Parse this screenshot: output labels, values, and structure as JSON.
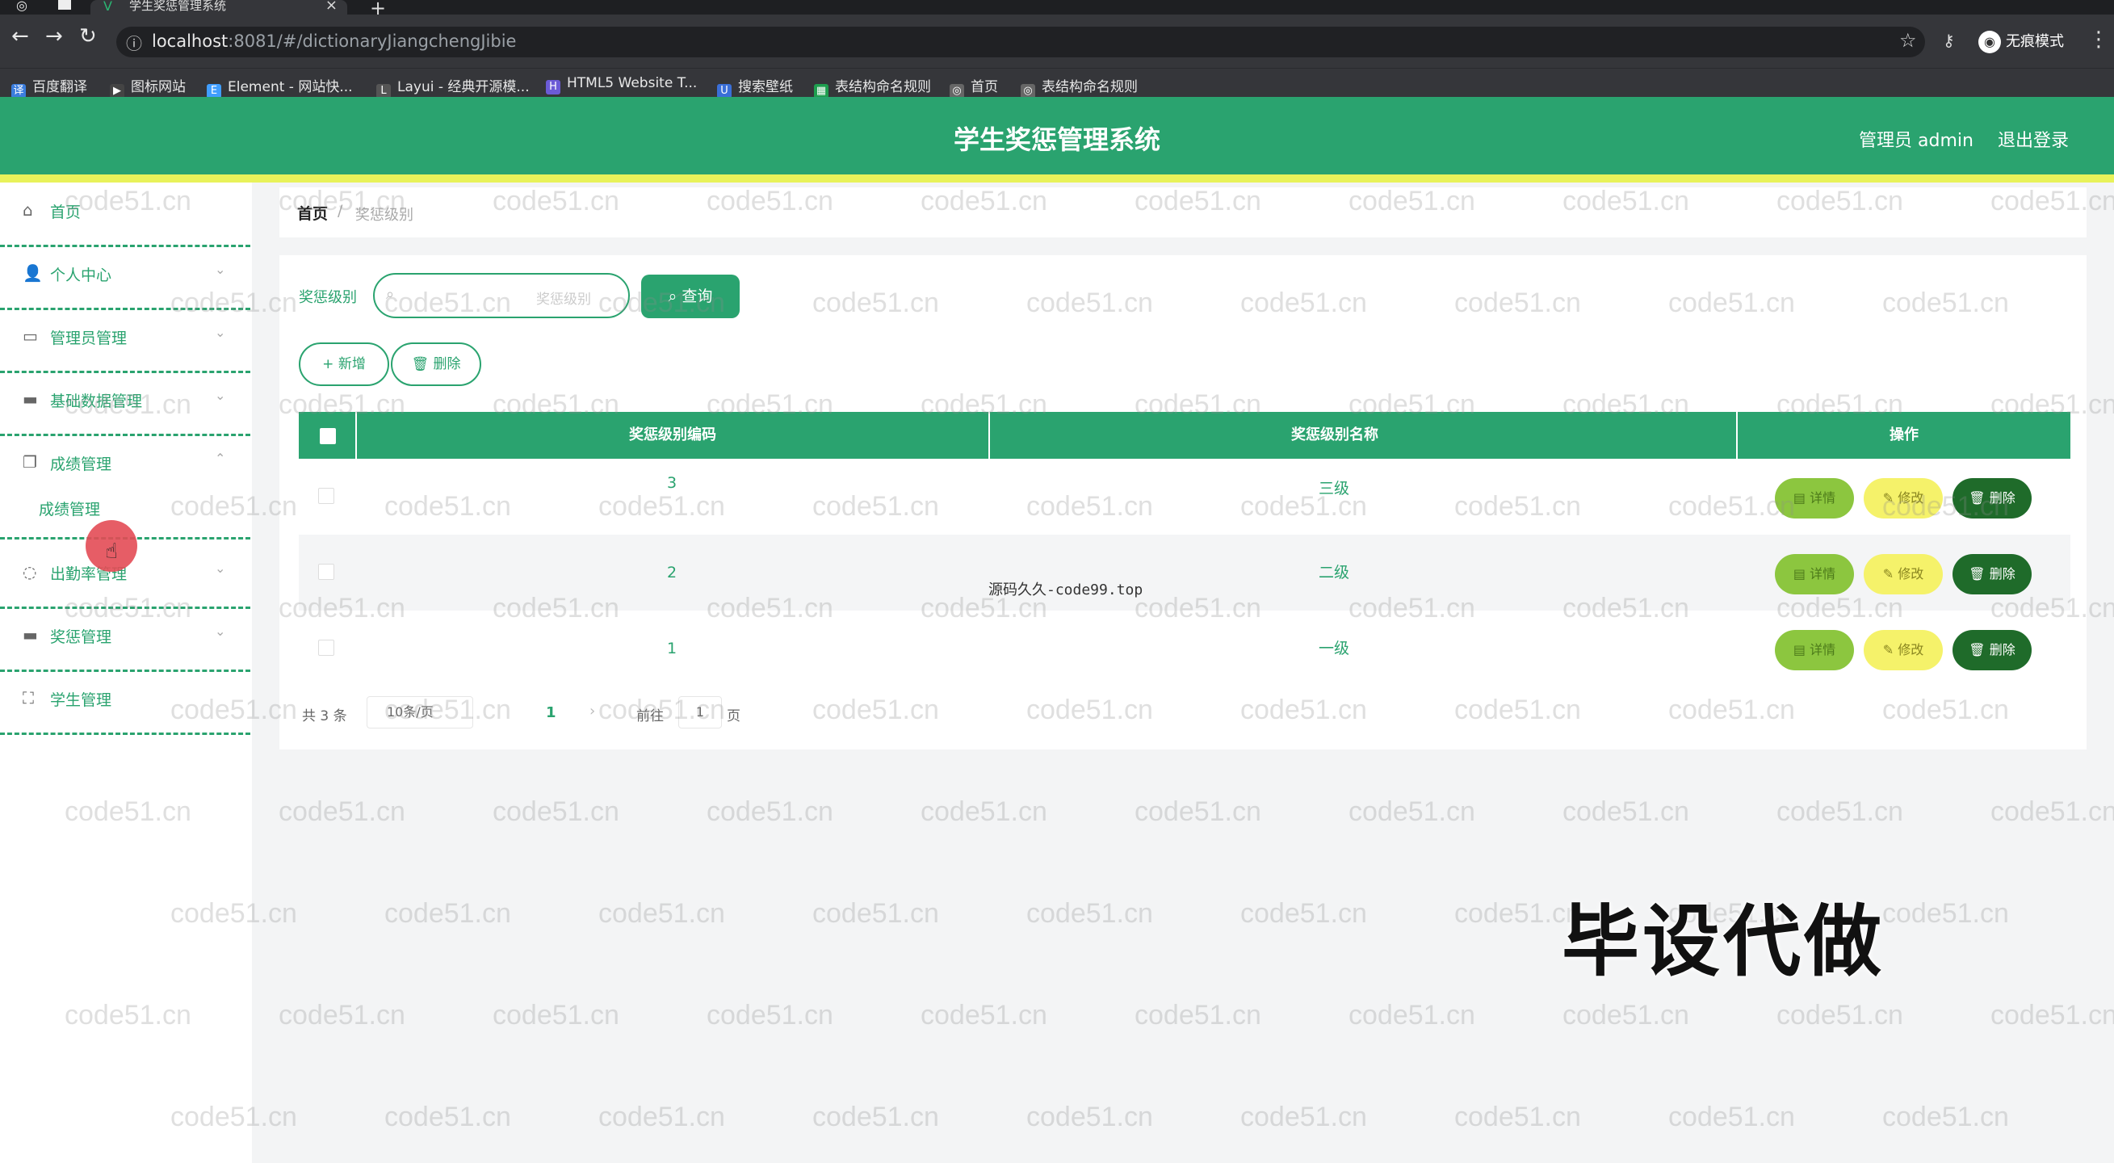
{
  "browser": {
    "tab_title": "学生奖惩管理系统",
    "url_host": "localhost",
    "url_rest": ":8081/#/dictionaryJiangchengJibie",
    "incognito_label": "无痕模式",
    "bookmarks": [
      "百度翻译",
      "图标网站",
      "Element - 网站快...",
      "Layui - 经典开源模...",
      "HTML5 Website T...",
      "搜索壁纸",
      "表结构命名规则",
      "首页",
      "表结构命名规则"
    ]
  },
  "header": {
    "title": "学生奖惩管理系统",
    "user": "管理员 admin",
    "logout": "退出登录"
  },
  "sidebar": {
    "items": [
      {
        "label": "首页",
        "icon": "home-icon"
      },
      {
        "label": "个人中心",
        "icon": "user-icon"
      },
      {
        "label": "管理员管理",
        "icon": "chat-icon"
      },
      {
        "label": "基础数据管理",
        "icon": "message-icon"
      },
      {
        "label": "成绩管理",
        "icon": "copy-icon"
      },
      {
        "label": "出勤率管理",
        "icon": "circle-icon"
      },
      {
        "label": "奖惩管理",
        "icon": "card-icon"
      },
      {
        "label": "学生管理",
        "icon": "expand-icon"
      }
    ],
    "sub_item": "成绩管理"
  },
  "breadcrumb": {
    "home": "首页",
    "separator": "/",
    "current": "奖惩级别"
  },
  "search": {
    "label": "奖惩级别",
    "placeholder": "奖惩级别",
    "query_button": "查询"
  },
  "toolbar": {
    "add": "新增",
    "delete": "删除"
  },
  "table": {
    "columns": [
      "奖惩级别编码",
      "奖惩级别名称",
      "操作"
    ],
    "rows": [
      {
        "code": "3",
        "name": "三级"
      },
      {
        "code": "2",
        "name": "二级"
      },
      {
        "code": "1",
        "name": "一级"
      }
    ],
    "actions": {
      "detail": "详情",
      "edit": "修改",
      "delete": "删除"
    }
  },
  "pagination": {
    "total": "共 3 条",
    "page_size": "10条/页",
    "current_page": "1",
    "goto_prefix": "前往",
    "goto_value": "1",
    "goto_suffix": "页"
  },
  "overlay": {
    "center_watermark": "源码久久-code99.top",
    "big_text": "毕设代做",
    "tiled_watermark": "code51.cn"
  },
  "colors": {
    "primary": "#2aa36f",
    "stripe": "#e8f25a",
    "detail_btn": "#8cc63f",
    "edit_btn": "#f5f26a",
    "delete_btn": "#1f6b2a"
  }
}
